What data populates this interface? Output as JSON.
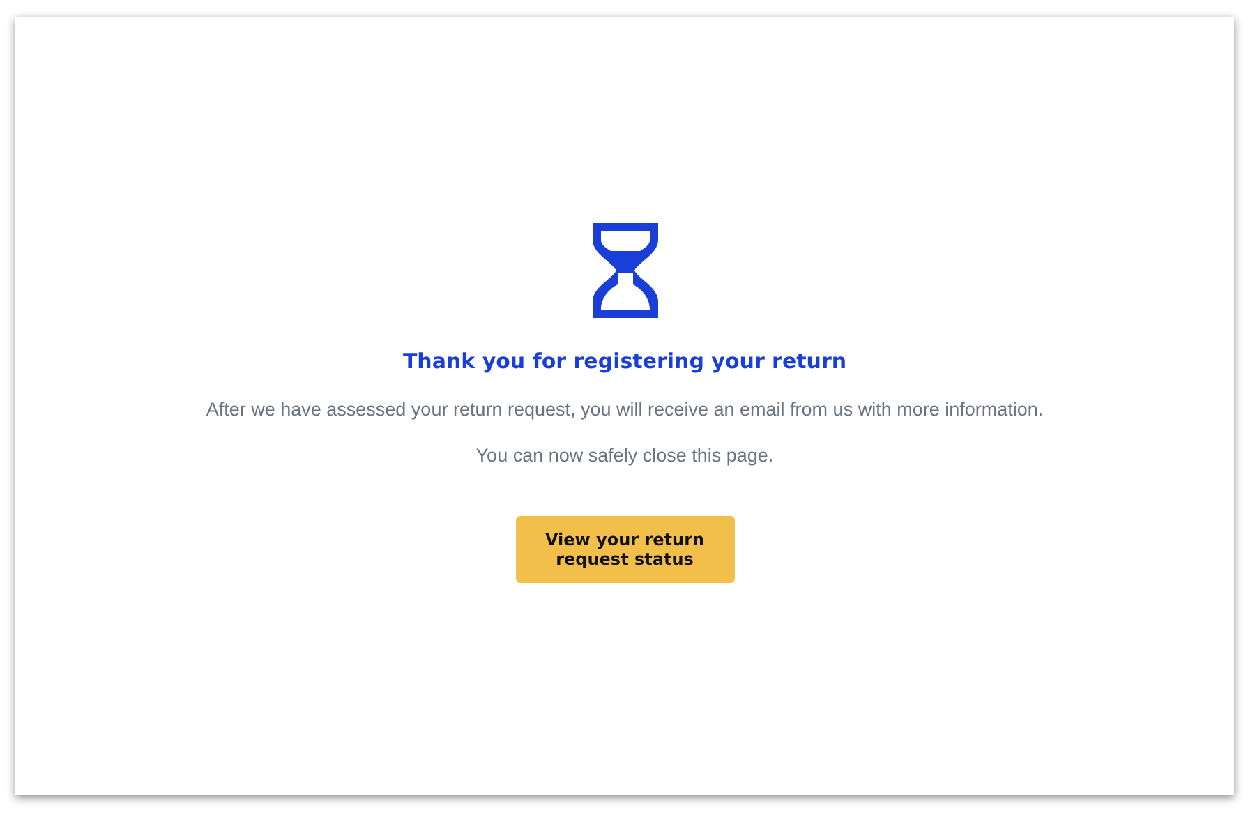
{
  "title": "Thank you for registering your return",
  "messages": [
    "After we have assessed your return request, you will receive an email from us with more information.",
    "You can now safely close this page."
  ],
  "button": {
    "label": "View your return request status"
  }
}
